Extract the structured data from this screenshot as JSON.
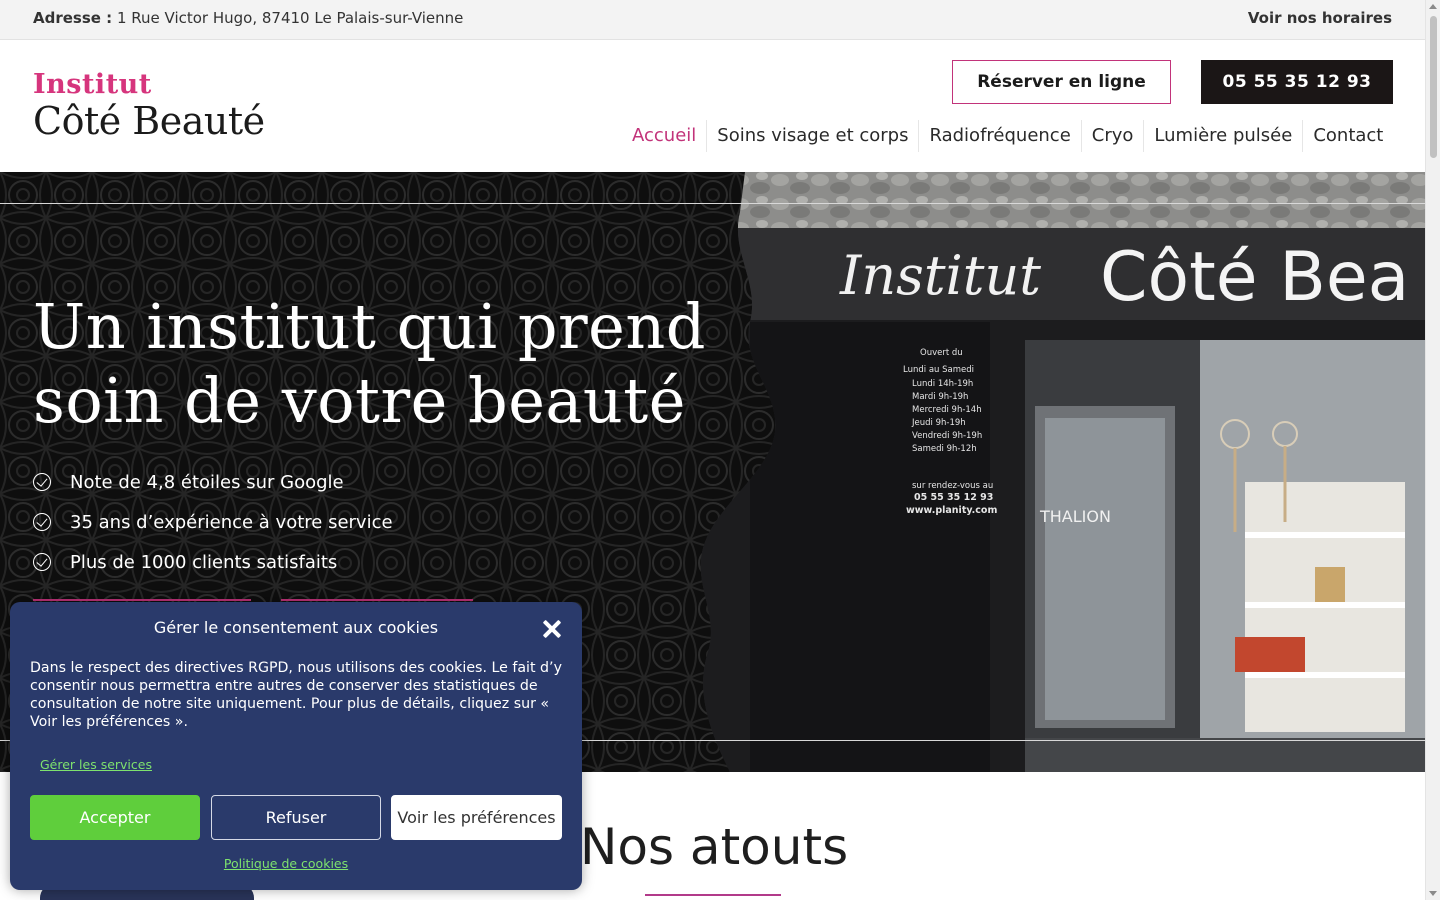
{
  "topbar": {
    "address_label": "Adresse :",
    "address": "1 Rue Victor Hugo, 87410 Le Palais-sur-Vienne",
    "hours_link": "Voir nos horaires"
  },
  "header": {
    "logo_line1": "Institut",
    "logo_line2": "Côté Beauté",
    "book_button": "Réserver en ligne",
    "phone_button": "05 55 35 12 93",
    "nav": [
      {
        "label": "Accueil",
        "active": true
      },
      {
        "label": "Soins visage et corps",
        "active": false
      },
      {
        "label": "Radiofréquence",
        "active": false
      },
      {
        "label": "Cryo",
        "active": false
      },
      {
        "label": "Lumière pulsée",
        "active": false
      },
      {
        "label": "Contact",
        "active": false
      }
    ]
  },
  "hero": {
    "title_line1": "Un institut qui prend",
    "title_line2": "soin de votre beauté",
    "bullets": [
      "Note de 4,8 étoiles sur Google",
      "35 ans d’expérience à votre service",
      "Plus de 1000 clients satisfaits"
    ],
    "shop_sign_script": "Institut",
    "shop_sign_main": "Côté Bea",
    "window_hours": [
      "Ouvert du",
      "Lundi au Samedi",
      "Lundi   14h-19h",
      "Mardi   9h-19h",
      "Mercredi  9h-14h",
      "Jeudi   9h-19h",
      "Vendredi  9h-19h",
      "Samedi  9h-12h"
    ],
    "window_appointment": "sur rendez-vous au",
    "window_phone": "05 55 35 12 93",
    "window_site": "www.planity.com",
    "window_brand": "THALION"
  },
  "section": {
    "title": "Nos atouts"
  },
  "cookie": {
    "title": "Gérer le consentement aux cookies",
    "text": "Dans le respect des directives RGPD, nous utilisons des cookies. Le fait d’y consentir nous permettra entre autres de conserver des statistiques de consultation de notre site uniquement. Pour plus de détails, cliquez sur « Voir les préférences ».",
    "manage_services": "Gérer les services",
    "accept": "Accepter",
    "refuse": "Refuser",
    "preferences": "Voir les préférences",
    "policy": "Politique de cookies"
  },
  "colors": {
    "accent": "#c2337a",
    "dark": "#1b1616",
    "cookie_bg": "#2a3a6b",
    "accept_green": "#5fce3c",
    "link_green": "#7ee26e"
  }
}
